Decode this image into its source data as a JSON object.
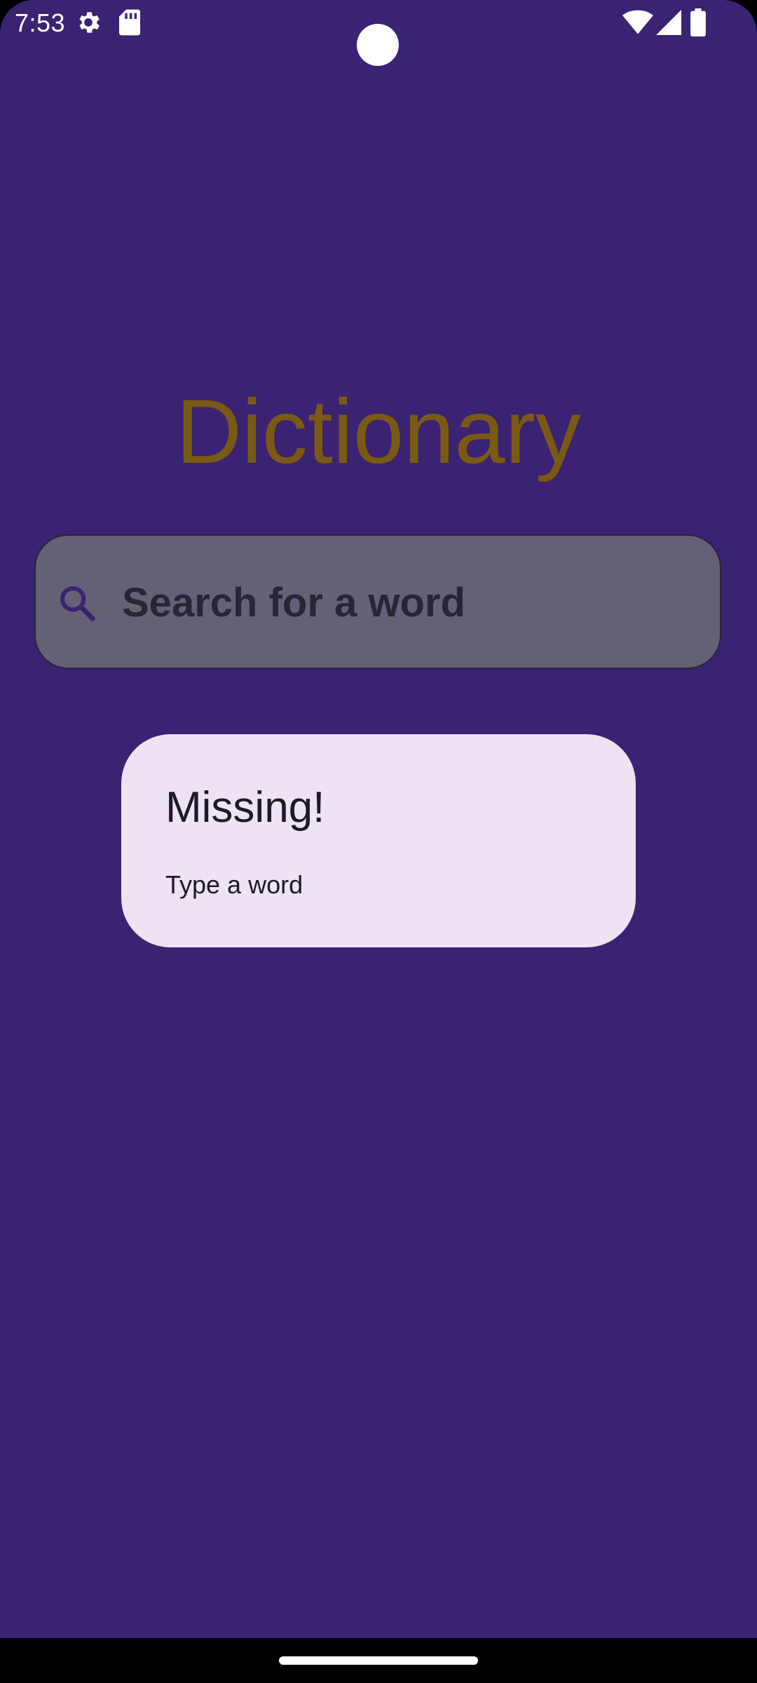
{
  "status_bar": {
    "time": "7:53",
    "icons": [
      "gear-icon",
      "sd-card-icon",
      "wifi-icon",
      "cellular-signal-icon",
      "battery-icon"
    ]
  },
  "app": {
    "title": "Dictionary"
  },
  "search": {
    "placeholder": "Search for a word",
    "icon": "search-icon"
  },
  "card": {
    "title": "Missing!",
    "subtitle": "Type a word"
  },
  "colors": {
    "background": "#3a2372",
    "title": "#7a5a12",
    "search_box": "#646075",
    "card": "#ede3f5"
  }
}
